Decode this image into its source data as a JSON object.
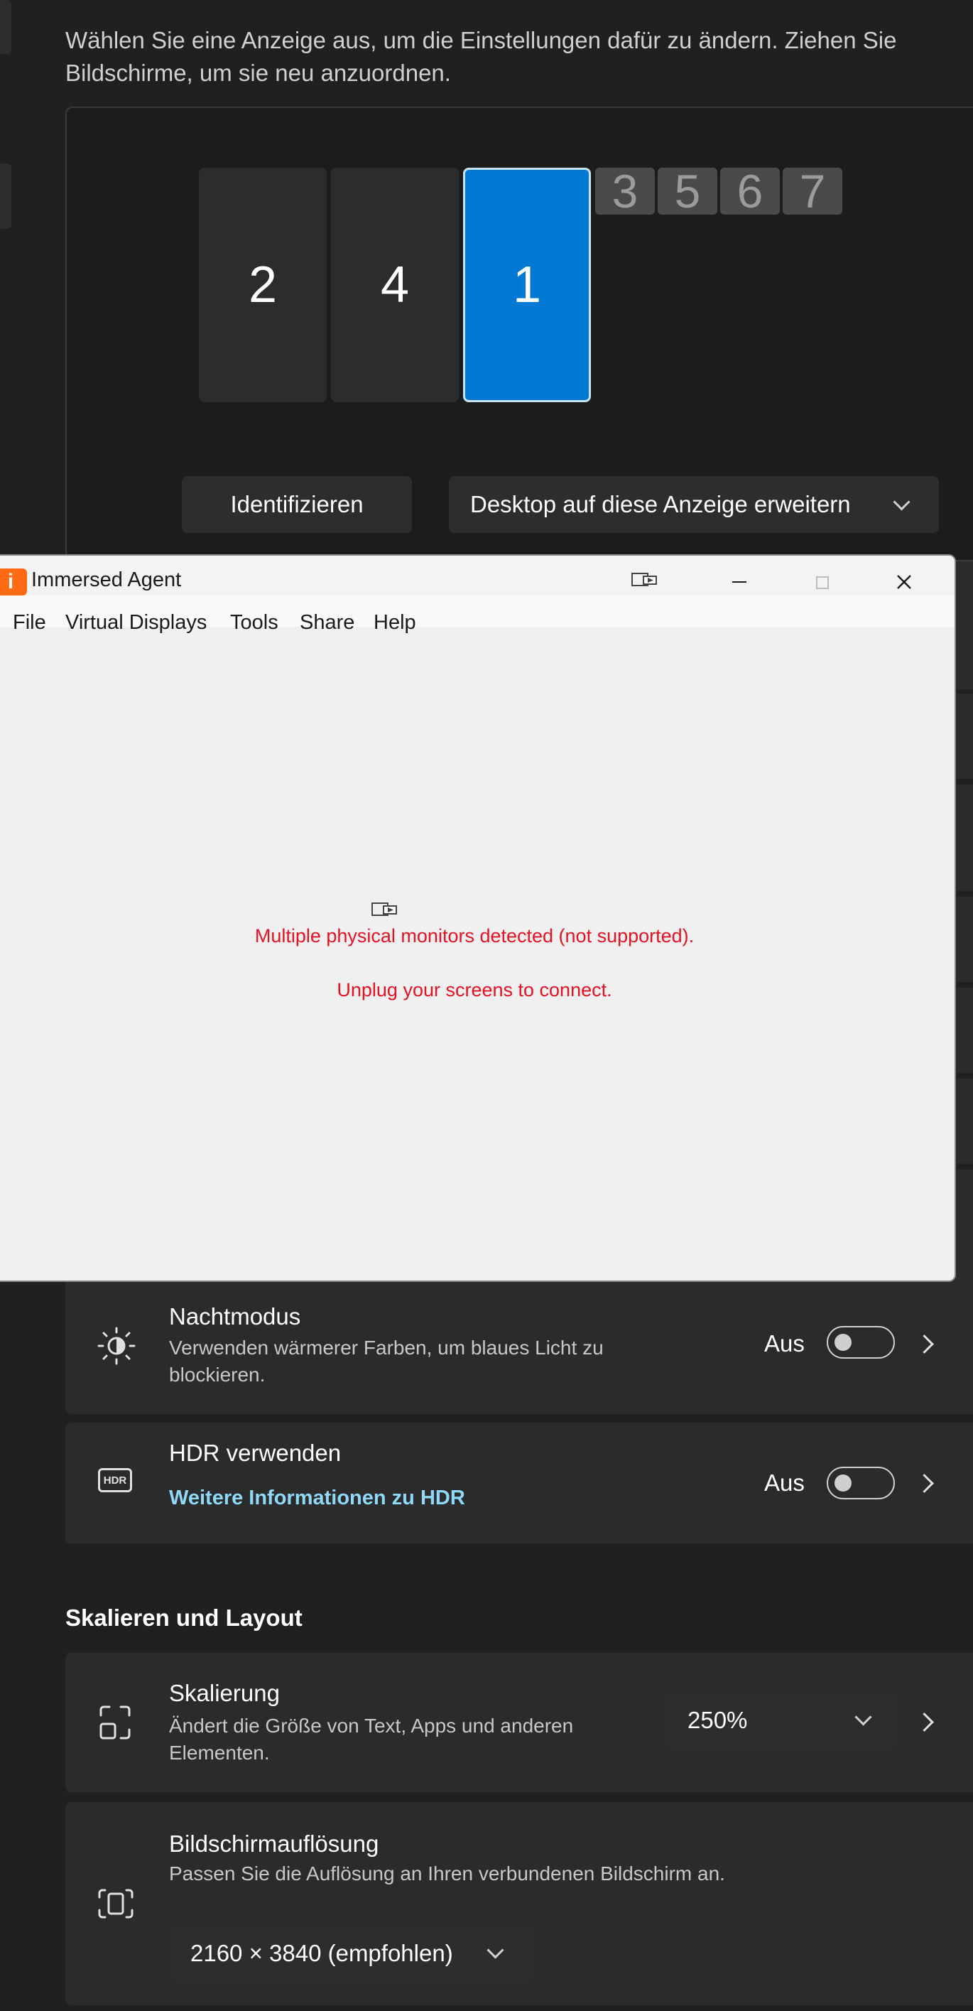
{
  "settings": {
    "intro": "Wählen Sie eine Anzeige aus, um die Einstellungen dafür zu ändern. Ziehen Sie Bildschirme, um sie neu anzuordnen.",
    "monitors": {
      "large": [
        "2",
        "4",
        "1"
      ],
      "small": [
        "3",
        "5",
        "6",
        "7"
      ],
      "selected": "1"
    },
    "identify_label": "Identifizieren",
    "extend_dropdown_value": "Desktop auf diese Anzeige erweitern",
    "night_mode": {
      "title": "Nachtmodus",
      "subtitle": "Verwenden wärmerer Farben, um blaues Licht zu blockieren.",
      "state": "Aus"
    },
    "hdr": {
      "icon_text": "HDR",
      "title": "HDR verwenden",
      "link": "Weitere Informationen zu HDR",
      "state": "Aus"
    },
    "scale_layout_heading": "Skalieren und Layout",
    "scaling": {
      "title": "Skalierung",
      "subtitle": "Ändert die Größe von Text, Apps und anderen Elementen.",
      "value": "250%"
    },
    "resolution": {
      "title": "Bildschirmauflösung",
      "subtitle": "Passen Sie die Auflösung an Ihren verbundenen Bildschirm an.",
      "value": "2160 × 3840 (empfohlen)"
    },
    "colors": {
      "accent": "#0078d4",
      "link": "#8fd8f8",
      "background": "#202020",
      "card": "#2b2b2b"
    }
  },
  "agent_window": {
    "icon_letter": "i",
    "title": "Immersed Agent",
    "menu": [
      "File",
      "Virtual Displays",
      "Tools",
      "Share",
      "Help"
    ],
    "error_line1": "Multiple physical monitors detected (not supported).",
    "error_line2": "Unplug your screens to connect.",
    "error_color": "#e81123"
  }
}
